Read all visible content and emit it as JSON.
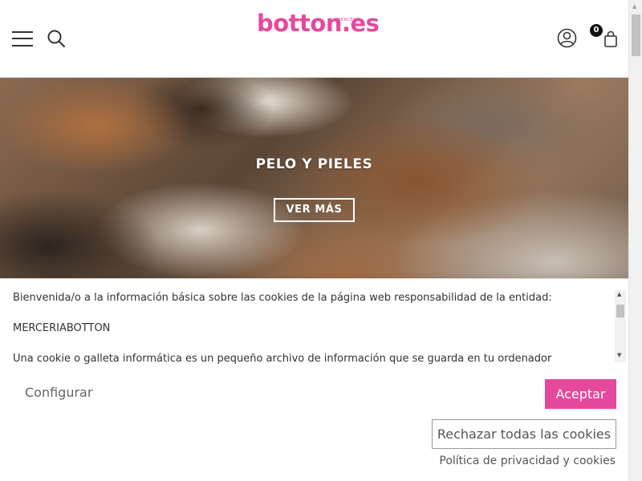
{
  "header": {
    "logo_text": "botton.es",
    "logo_tagline": "MERCERÍA",
    "cart_count": "0",
    "icons": {
      "menu": "hamburger-menu-icon",
      "search": "search-icon",
      "user": "user-account-icon",
      "cart": "shopping-bag-icon"
    }
  },
  "hero": {
    "title": "PELO Y PIELES",
    "button_label": "VER MÁS"
  },
  "cookies": {
    "paragraphs": [
      "Bienvenida/o a la información básica sobre las cookies de la página web responsabilidad de la entidad:",
      "MERCERIABOTTON",
      "Una cookie o galleta informática es un pequeño archivo de información que se guarda en tu ordenador"
    ],
    "configure_label": "Configurar",
    "accept_label": "Aceptar",
    "reject_label": "Rechazar todas las cookies",
    "policy_label": "Política de privacidad y cookies"
  },
  "colors": {
    "brand_pink": "#e6499c",
    "text": "#333333"
  }
}
